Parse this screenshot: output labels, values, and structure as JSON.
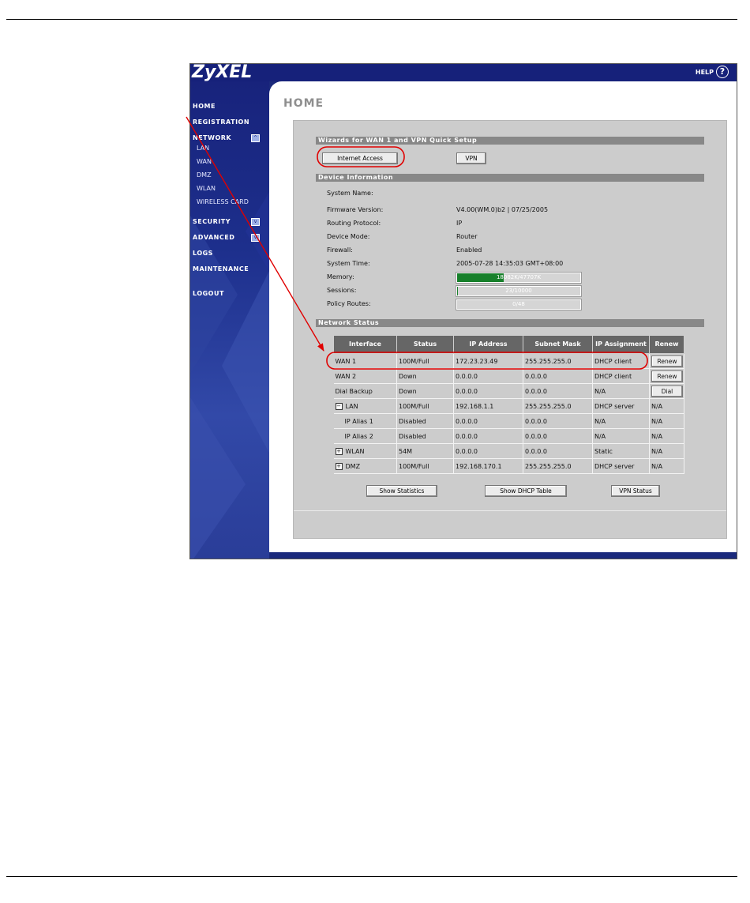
{
  "app": {
    "logo": "ZyXEL",
    "help_label": "HELP",
    "help_icon": "?"
  },
  "sidebar": {
    "items": [
      {
        "label": "HOME"
      },
      {
        "label": "REGISTRATION"
      },
      {
        "label": "NETWORK"
      },
      {
        "label": "SECURITY"
      },
      {
        "label": "ADVANCED"
      },
      {
        "label": "LOGS"
      },
      {
        "label": "MAINTENANCE"
      },
      {
        "label": "LOGOUT"
      }
    ],
    "network_sub": [
      {
        "label": "LAN"
      },
      {
        "label": "WAN"
      },
      {
        "label": "DMZ"
      },
      {
        "label": "WLAN"
      },
      {
        "label": "WIRELESS CARD"
      }
    ]
  },
  "page": {
    "title": "HOME"
  },
  "wizards": {
    "title": "Wizards for WAN 1 and VPN Quick Setup",
    "internet_access": "Internet Access",
    "vpn": "VPN"
  },
  "device": {
    "title": "Device Information",
    "system_name_label": "System Name:",
    "system_name_value": "",
    "firmware_label": "Firmware Version:",
    "firmware_value": "V4.00(WM.0)b2 | 07/25/2005",
    "routing_label": "Routing Protocol:",
    "routing_value": "IP",
    "mode_label": "Device Mode:",
    "mode_value": "Router",
    "firewall_label": "Firewall:",
    "firewall_value": "Enabled",
    "time_label": "System Time:",
    "time_value": "2005-07-28  14:35:03  GMT+08:00",
    "memory_label": "Memory:",
    "memory_text": "18082K/47707K",
    "memory_fraction": 0.379,
    "sessions_label": "Sessions:",
    "sessions_text": "23/10000",
    "sessions_fraction": 0.0023,
    "policy_label": "Policy Routes:",
    "policy_text": "0/48",
    "policy_fraction": 0
  },
  "network": {
    "title": "Network Status",
    "headers": {
      "interface": "Interface",
      "status": "Status",
      "ip": "IP Address",
      "mask": "Subnet Mask",
      "assign": "IP Assignment",
      "renew": "Renew"
    },
    "rows": [
      {
        "iface": "WAN 1",
        "status": "100M/Full",
        "ip": "172.23.23.49",
        "mask": "255.255.255.0",
        "assign": "DHCP client",
        "renew": "Renew"
      },
      {
        "iface": "WAN 2",
        "status": "Down",
        "ip": "0.0.0.0",
        "mask": "0.0.0.0",
        "assign": "DHCP client",
        "renew": "Renew"
      },
      {
        "iface": "Dial Backup",
        "status": "Down",
        "ip": "0.0.0.0",
        "mask": "0.0.0.0",
        "assign": "N/A",
        "renew": "Dial"
      },
      {
        "iface": "LAN",
        "status": "100M/Full",
        "ip": "192.168.1.1",
        "mask": "255.255.255.0",
        "assign": "DHCP server",
        "renew": "N/A",
        "toggle": "−"
      },
      {
        "iface": "IP Alias 1",
        "status": "Disabled",
        "ip": "0.0.0.0",
        "mask": "0.0.0.0",
        "assign": "N/A",
        "renew": "N/A"
      },
      {
        "iface": "IP Alias 2",
        "status": "Disabled",
        "ip": "0.0.0.0",
        "mask": "0.0.0.0",
        "assign": "N/A",
        "renew": "N/A"
      },
      {
        "iface": "WLAN",
        "status": "54M",
        "ip": "0.0.0.0",
        "mask": "0.0.0.0",
        "assign": "Static",
        "renew": "N/A",
        "toggle": "+"
      },
      {
        "iface": "DMZ",
        "status": "100M/Full",
        "ip": "192.168.170.1",
        "mask": "255.255.255.0",
        "assign": "DHCP server",
        "renew": "N/A",
        "toggle": "+"
      }
    ],
    "show_statistics": "Show Statistics",
    "show_dhcp": "Show DHCP Table",
    "vpn_status": "VPN Status"
  },
  "colors": {
    "annotation": "#e00000",
    "sidebar": "#1b2a7c",
    "memory_bar": "#17802b"
  }
}
